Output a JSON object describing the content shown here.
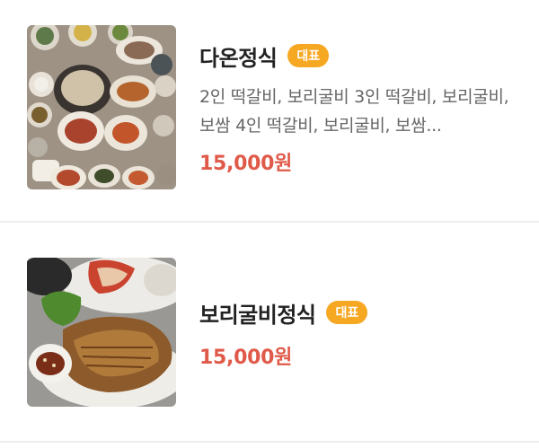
{
  "menu": {
    "items": [
      {
        "name": "다온정식",
        "badge": "대표",
        "description": "2인 떡갈비, 보리굴비 3인 떡갈비, 보리굴비, 보쌈 4인 떡갈비, 보리굴비, 보쌈...",
        "price": "15,000원"
      },
      {
        "name": "보리굴비정식",
        "badge": "대표",
        "price": "15,000원"
      }
    ]
  },
  "colors": {
    "badge": "#f6a823",
    "price": "#e05a4a",
    "divider": "#eeeeee"
  }
}
